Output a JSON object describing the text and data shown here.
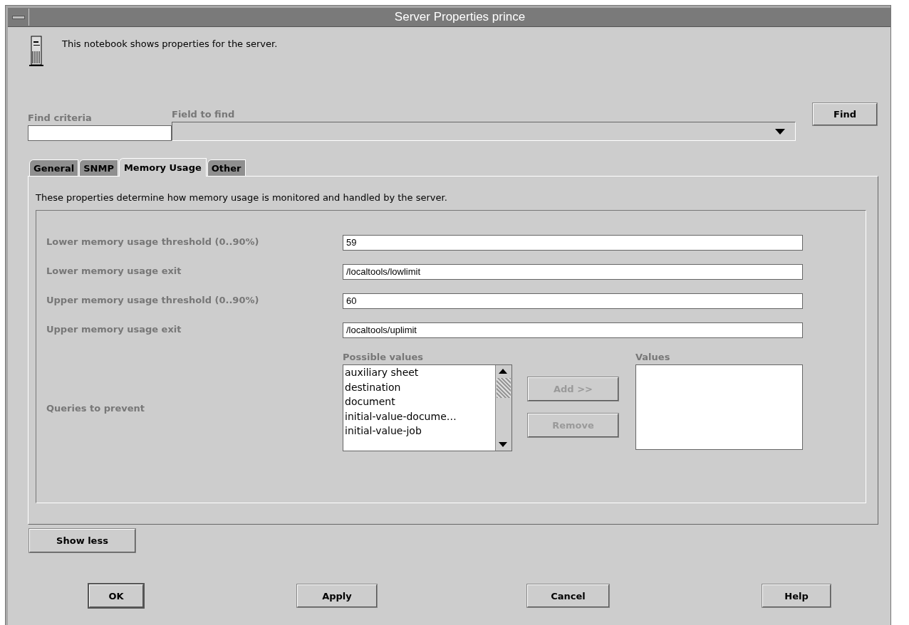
{
  "window": {
    "title": "Server Properties prince"
  },
  "intro": "This notebook shows properties for the server.",
  "find": {
    "criteria_label": "Find criteria",
    "field_label": "Field to find",
    "button": "Find"
  },
  "tabs": [
    {
      "label": "General",
      "selected": false
    },
    {
      "label": "SNMP",
      "selected": false
    },
    {
      "label": "Memory Usage",
      "selected": true
    },
    {
      "label": "Other",
      "selected": false
    }
  ],
  "description": "These properties determine how memory usage is monitored and handled by the server.",
  "rows": [
    {
      "label": "Lower memory usage threshold (0..90%)",
      "value": "59"
    },
    {
      "label": "Lower memory usage exit",
      "value": "/localtools/lowlimit"
    },
    {
      "label": "Upper memory usage threshold (0..90%)",
      "value": "60"
    },
    {
      "label": "Upper memory usage exit",
      "value": "/localtools/uplimit"
    }
  ],
  "queries": {
    "label": "Queries to prevent",
    "possible_label": "Possible values",
    "possible_items": [
      "auxiliary sheet",
      "destination",
      "document",
      "initial-value-docume…",
      "initial-value-job"
    ],
    "add": {
      "label": "Add >>",
      "disabled": true
    },
    "remove": {
      "label": "Remove",
      "disabled": true
    },
    "values_label": "Values"
  },
  "show_less": "Show less",
  "buttons": [
    {
      "label": "OK",
      "default": true
    },
    {
      "label": "Apply",
      "default": false
    },
    {
      "label": "Cancel",
      "default": false
    },
    {
      "label": "Help",
      "default": false
    }
  ]
}
